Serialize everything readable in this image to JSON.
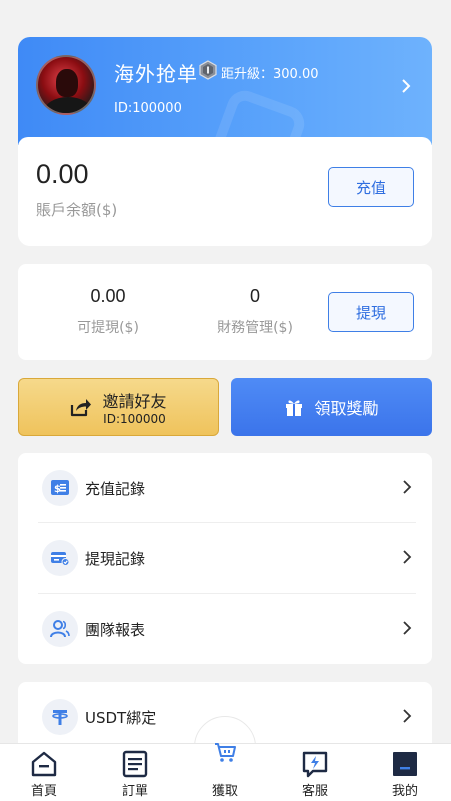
{
  "profile": {
    "username": "海外抢单",
    "upgrade_text": "距升級：300.00",
    "user_id": "ID:100000",
    "balance_value": "0.00",
    "balance_label": "賬戶余額($)",
    "recharge_label": "充值"
  },
  "finance": {
    "withdrawable_value": "0.00",
    "withdrawable_label": "可提現($)",
    "finance_value": "0",
    "finance_label": "財務管理($)",
    "withdraw_label": "提現"
  },
  "actions": {
    "invite_label": "邀請好友",
    "invite_id": "ID:100000",
    "reward_label": "領取獎勵"
  },
  "menu": {
    "items": [
      {
        "label": "充值記錄",
        "icon": "recharge-record-icon"
      },
      {
        "label": "提現記錄",
        "icon": "withdraw-record-icon"
      },
      {
        "label": "團隊報表",
        "icon": "team-report-icon"
      }
    ],
    "usdt": {
      "label": "USDT綁定",
      "icon": "usdt-icon"
    }
  },
  "tabbar": {
    "items": [
      {
        "label": "首頁",
        "icon": "home-icon"
      },
      {
        "label": "訂單",
        "icon": "orders-icon"
      },
      {
        "label": "獲取",
        "icon": "cart-icon"
      },
      {
        "label": "客服",
        "icon": "service-icon"
      },
      {
        "label": "我的",
        "icon": "profile-icon"
      }
    ]
  },
  "colors": {
    "primary": "#3f80f0",
    "gold": "#efc35c",
    "card_gradient_start": "#3f8af6",
    "card_gradient_end": "#6eb2fd"
  }
}
